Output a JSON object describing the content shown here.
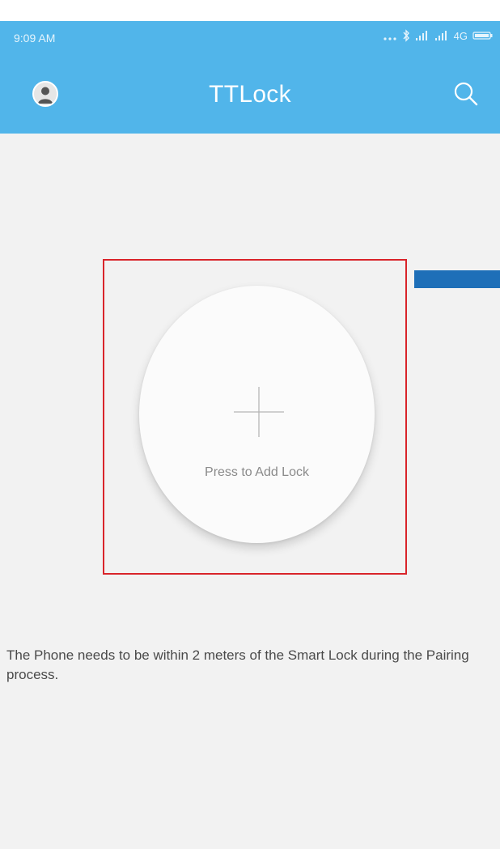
{
  "status_bar": {
    "time": "9:09 AM",
    "network": "4G",
    "icons": [
      "more-dots-icon",
      "bluetooth-icon",
      "signal-icon",
      "signal-icon",
      "battery-icon"
    ]
  },
  "toolbar": {
    "title": "TTLock",
    "left_icon": "user-avatar-icon",
    "right_icon": "search-icon"
  },
  "main": {
    "add_lock_label": "Press to Add Lock",
    "add_lock_icon": "plus-icon",
    "hint": "The Phone needs to be within 2 meters of the Smart Lock during the Pairing process."
  },
  "colors": {
    "app_bar": "#51b5ea",
    "background": "#f2f2f2",
    "highlight_border": "#d9242a",
    "pointer_arrow": "#1e6fb8"
  }
}
